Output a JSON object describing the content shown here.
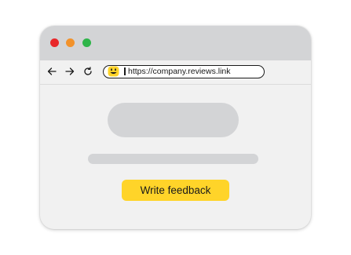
{
  "window": {
    "controls": [
      "close",
      "minimize",
      "maximize"
    ],
    "control_colors": {
      "close": "#e8272a",
      "minimize": "#f2922b",
      "maximize": "#2fb54a"
    }
  },
  "navbar": {
    "back_icon": "arrow-left-icon",
    "forward_icon": "arrow-right-icon",
    "reload_icon": "reload-icon"
  },
  "address_bar": {
    "favicon": "smiley-face-icon",
    "url": "https://company.reviews.link"
  },
  "content": {
    "cta_label": "Write feedback",
    "cta_color": "#ffd429"
  }
}
